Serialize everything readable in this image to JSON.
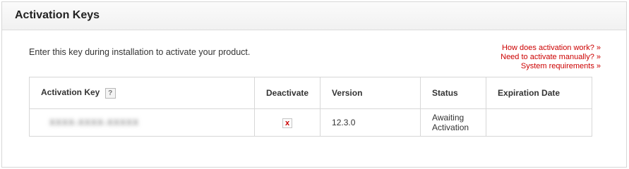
{
  "panel": {
    "title": "Activation Keys"
  },
  "intro_text": "Enter this key during installation to activate your product.",
  "help_links": [
    {
      "label": "How does activation work? »"
    },
    {
      "label": "Need to activate manually? »"
    },
    {
      "label": "System requirements »"
    }
  ],
  "table": {
    "headers": {
      "key": "Activation Key",
      "key_help": "?",
      "deactivate": "Deactivate",
      "version": "Version",
      "status": "Status",
      "expiration": "Expiration Date"
    },
    "rows": [
      {
        "key": "XXXX-XXXX-XXXXX",
        "deactivate_symbol": "x",
        "version": "12.3.0",
        "status": "Awaiting Activation",
        "expiration": ""
      }
    ]
  },
  "colors": {
    "link": "#cc0000",
    "border": "#d7d7d7",
    "header_bg": "#f1f1f1"
  }
}
